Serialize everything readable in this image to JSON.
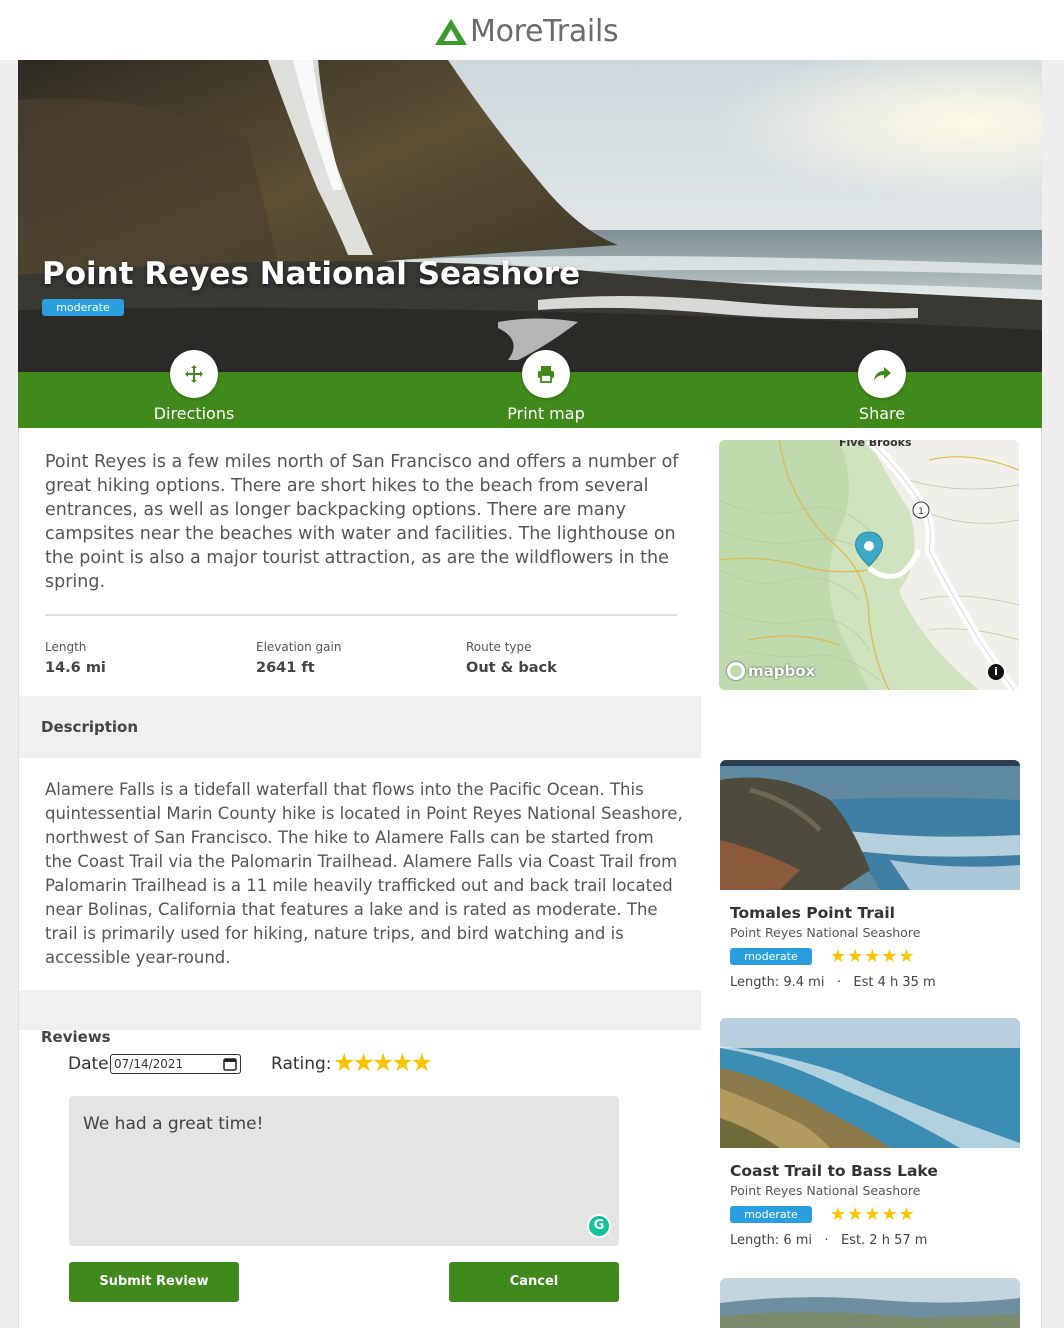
{
  "app": {
    "name": "MoreTrails",
    "brand_color": "#3f8a1b"
  },
  "trail": {
    "title": "Point Reyes National Seashore",
    "difficulty": "moderate",
    "intro": "Point Reyes is a few miles north of San Francisco and offers a number of great hiking options. There are short hikes to the beach from several entrances, as well as longer backpacking options. There are many campsites near the beaches with water and facilities. The lighthouse on the point is also a major tourist attraction, as are the wildflowers in the spring.",
    "stats": [
      {
        "label": "Length",
        "value": "14.6 mi"
      },
      {
        "label": "Elevation gain",
        "value": "2641 ft"
      },
      {
        "label": "Route type",
        "value": "Out & back"
      }
    ],
    "description_heading": "Description",
    "description": "Alamere Falls is a tidefall waterfall that flows into the Pacific Ocean. This quintessential Marin County hike is located in Point Reyes National Seashore, northwest of San Francisco. The hike to Alamere Falls can be started from the Coast Trail via the Palomarin Trailhead. Alamere Falls via Coast Trail from Palomarin Trailhead is a 11 mile heavily trafficked out and back trail located near Bolinas, California that features a lake and is rated as moderate. The trail is primarily used for hiking, nature trips, and bird watching and is accessible year-round."
  },
  "actions": {
    "directions": "Directions",
    "print": "Print map",
    "share": "Share"
  },
  "map": {
    "label": "Five Brooks",
    "road_shield": "1",
    "attribution": "mapbox",
    "info": "i"
  },
  "reviews": {
    "heading": "Reviews",
    "date_label": "Date",
    "date_value": "07/14/2021",
    "rating_label": "Rating:",
    "rating_stars": "★★★★★",
    "text": "We had a great time!",
    "submit_label": "Submit Review",
    "cancel_label": "Cancel"
  },
  "related": [
    {
      "title": "Tomales Point Trail",
      "park": "Point Reyes National Seashore",
      "difficulty": "moderate",
      "stars": "★★★★★",
      "meta": "Length: 9.4 mi   ·   Est 4 h 35 m"
    },
    {
      "title": "Coast Trail to Bass Lake",
      "park": "Point Reyes National Seashore",
      "difficulty": "moderate",
      "stars": "★★★★★",
      "meta": "Length: 6 mi   ·   Est. 2 h 57 m"
    }
  ],
  "colors": {
    "badge": "#2a9fe0",
    "star": "#f7c600",
    "section_bg": "#f0f0f0"
  }
}
